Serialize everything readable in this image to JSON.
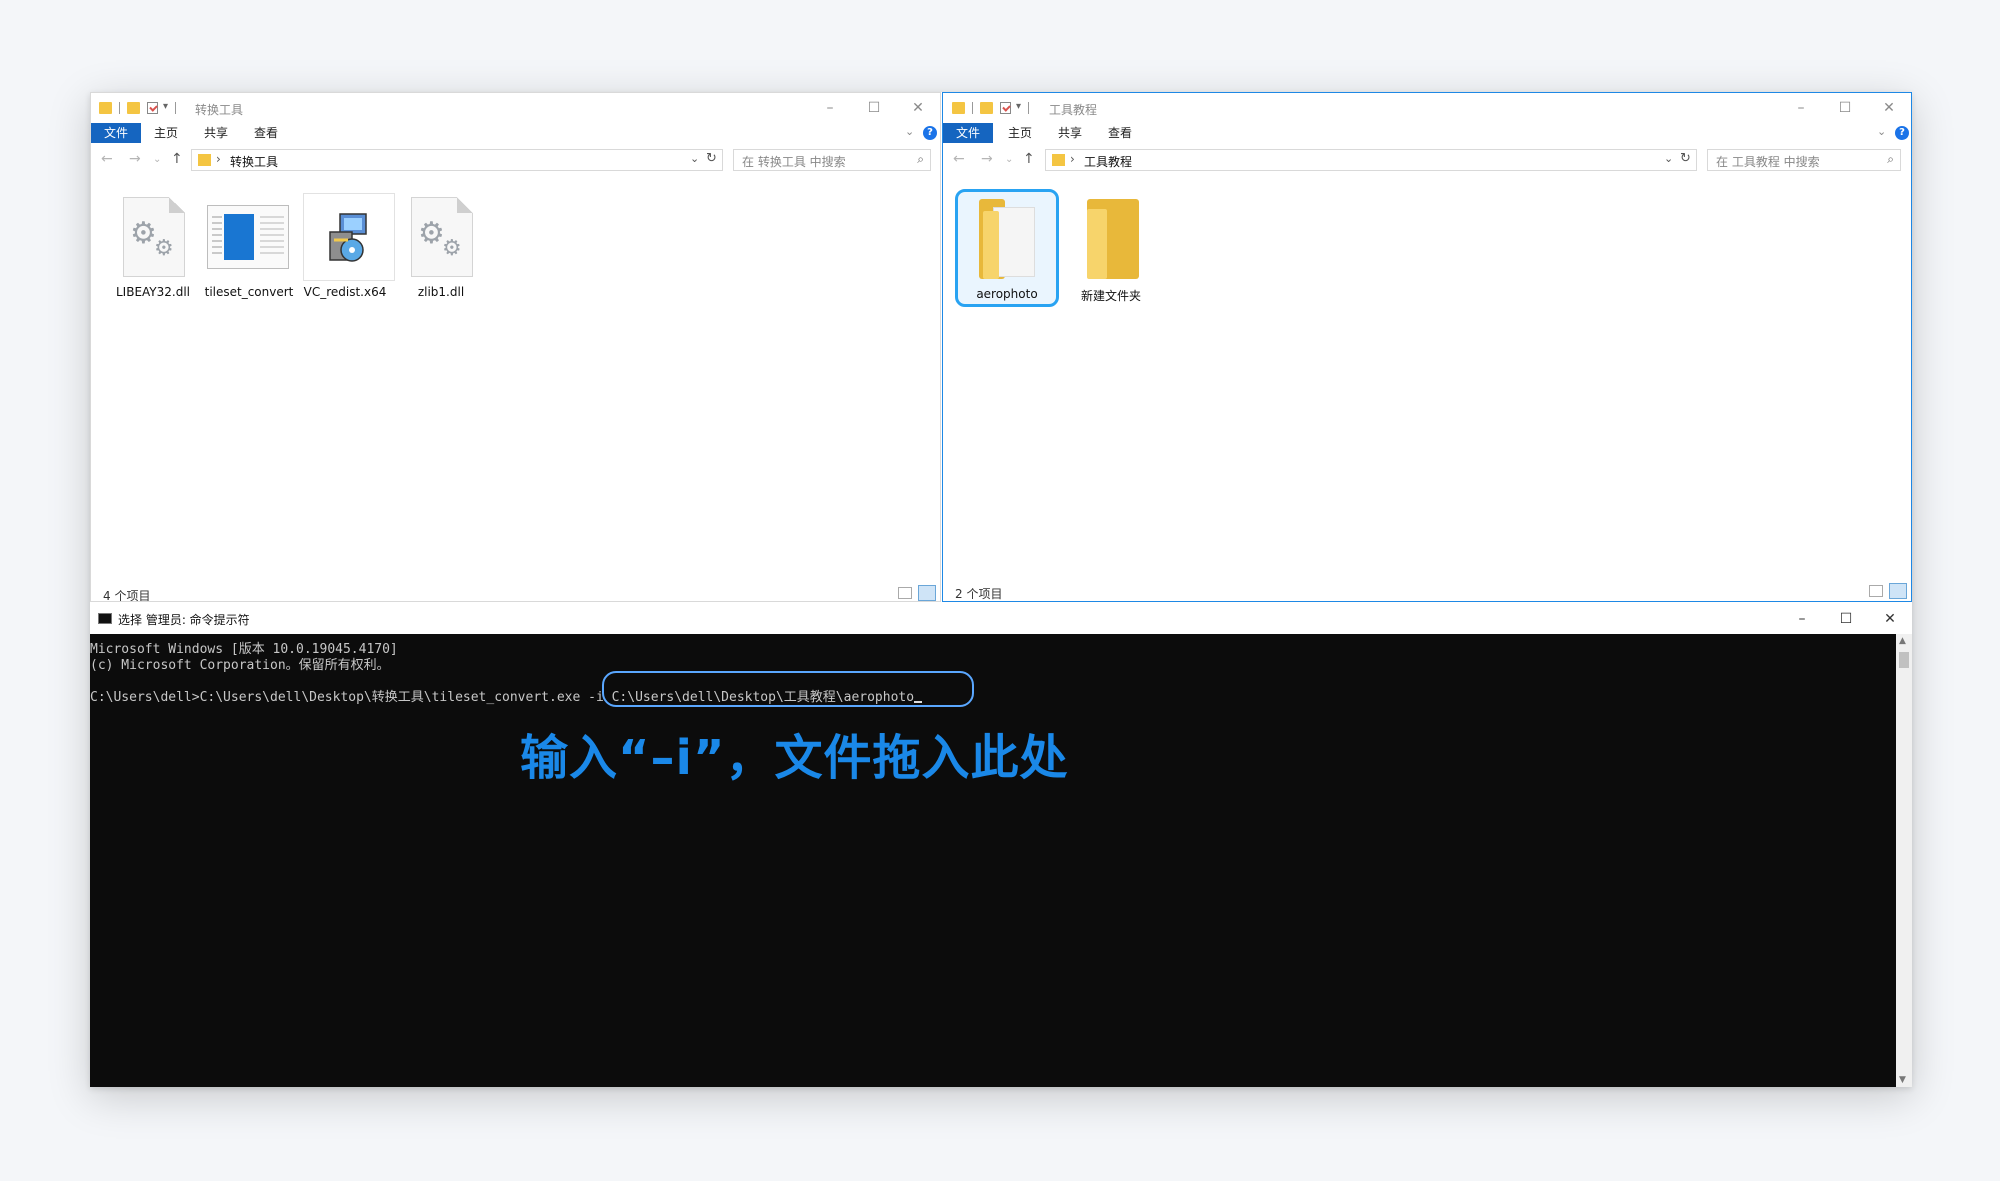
{
  "left_explorer": {
    "title": "转换工具",
    "ribbon_tabs": [
      "文件",
      "主页",
      "共享",
      "查看"
    ],
    "address_path": "转换工具",
    "search_placeholder": "在 转换工具 中搜索",
    "status": "4 个项目",
    "files": [
      {
        "name": "LIBEAY32.dll",
        "icon": "gear-dll-icon"
      },
      {
        "name": "tileset_convert",
        "icon": "application-icon"
      },
      {
        "name": "VC_redist.x64",
        "icon": "installer-icon"
      },
      {
        "name": "zlib1.dll",
        "icon": "gear-dll-icon"
      }
    ]
  },
  "right_explorer": {
    "title": "工具教程",
    "ribbon_tabs": [
      "文件",
      "主页",
      "共享",
      "查看"
    ],
    "address_path": "工具教程",
    "search_placeholder": "在 工具教程 中搜索",
    "status": "2 个项目",
    "files": [
      {
        "name": "aerophoto",
        "icon": "folder-icon",
        "selected": true
      },
      {
        "name": "新建文件夹",
        "icon": "folder-icon",
        "selected": false
      }
    ]
  },
  "cmd": {
    "title": "选择 管理员: 命令提示符",
    "lines": [
      "Microsoft Windows [版本 10.0.19045.4170]",
      "(c) Microsoft Corporation。保留所有权利。",
      "",
      "C:\\Users\\dell>C:\\Users\\dell\\Desktop\\转换工具\\tileset_convert.exe"
    ],
    "highlighted_args": "-i C:\\Users\\dell\\Desktop\\工具教程\\aerophoto"
  },
  "annotation": "输入“–i”，文件拖入此处",
  "colors": {
    "accent": "#1565c0",
    "selection": "#29a3f2",
    "annotation": "#1a88e8",
    "console_bg": "#0c0c0c"
  }
}
